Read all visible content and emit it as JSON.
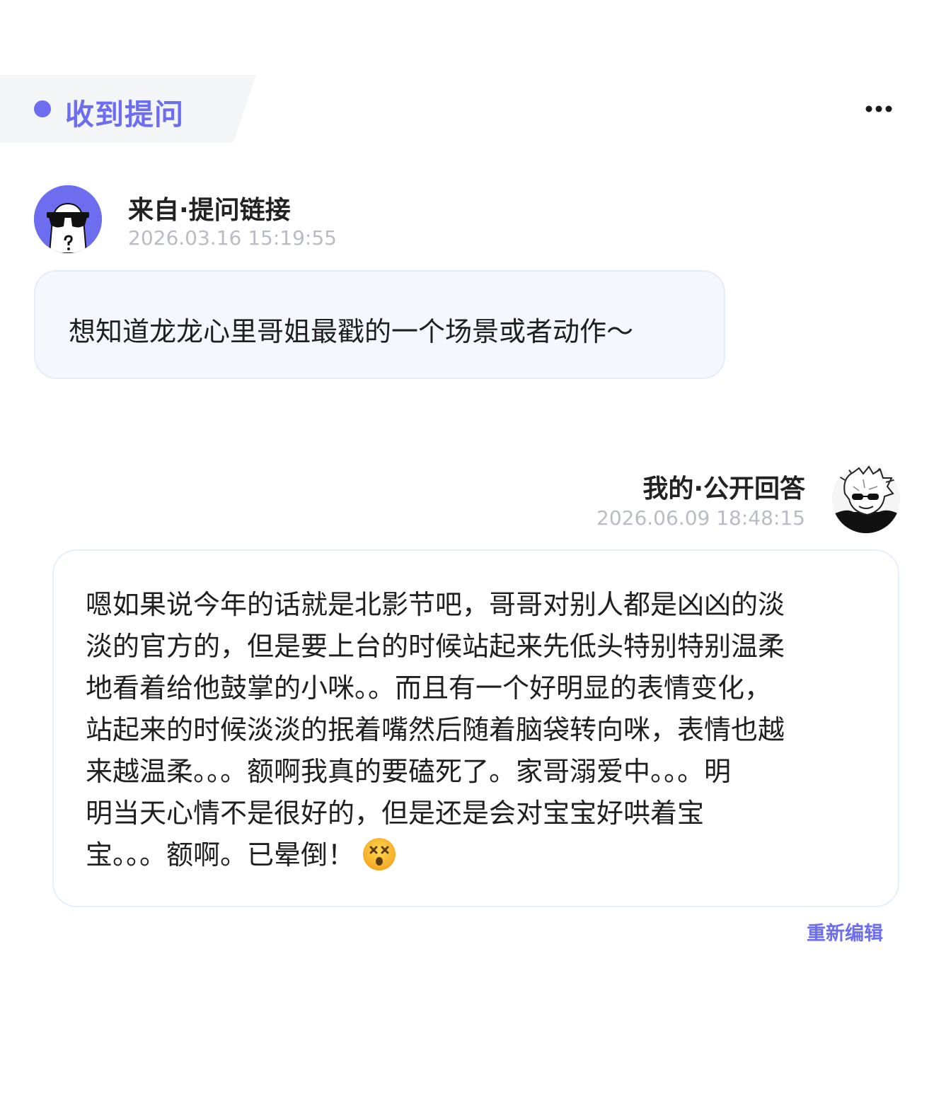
{
  "header": {
    "tag_label": "收到提问",
    "more_icon": "more-dots-icon",
    "accent_color": "#6d6df0"
  },
  "question": {
    "sender": "来自·提问链接",
    "timestamp": "2026.03.16 15:19:55",
    "avatar_icon": "anonymous-sunglasses-avatar",
    "text": "想知道龙龙心里哥姐最戳的一个场景或者动作～"
  },
  "answer": {
    "sender": "我的·公开回答",
    "timestamp": "2026.06.09 18:48:15",
    "avatar_icon": "user-avatar",
    "lines": [
      "嗯如果说今年的话就是北影节吧，哥哥对别人都是凶凶的淡",
      "淡的官方的，但是要上台的时候站起来先低头特别特别温柔",
      "地看着给他鼓掌的小咪。。而且有一个好明显的表情变化，",
      "站起来的时候淡淡的抿着嘴然后随着脑袋转向咪，表情也越",
      "来越温柔。。。额啊我真的要磕死了。家哥溺爱中。。。明",
      "明当天心情不是很好的，但是还是会对宝宝好哄着宝",
      "宝。。。额啊。已晕倒！"
    ],
    "emoji_icon": "dizzy-face-emoji",
    "reedit_label": "重新编辑"
  }
}
